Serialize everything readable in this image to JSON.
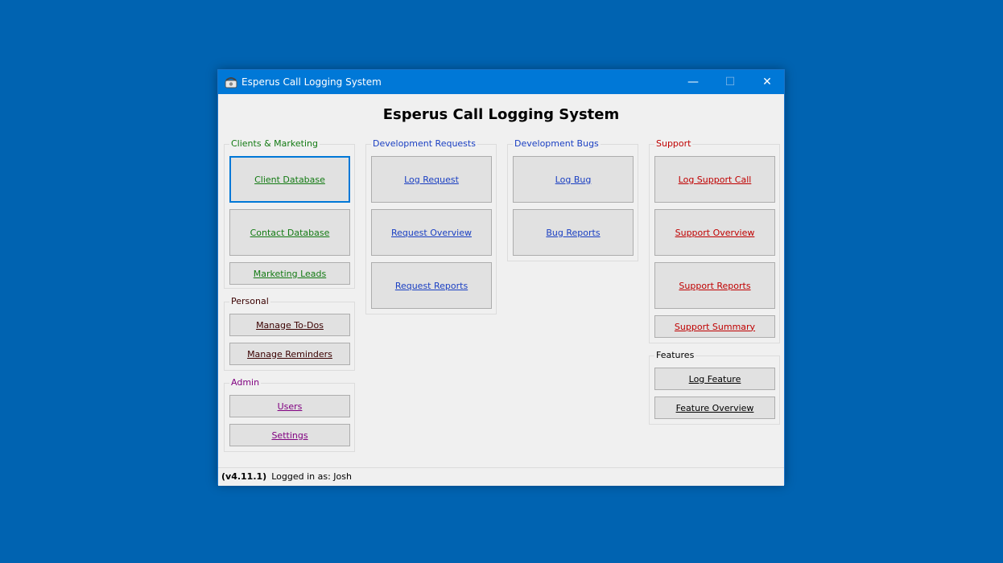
{
  "window": {
    "title": "Esperus Call Logging System",
    "minimize": "—",
    "maximize": "☐",
    "close": "✕"
  },
  "heading": "Esperus Call Logging System",
  "groups": {
    "clients": {
      "label": "Clients & Marketing",
      "buttons": [
        "Client Database",
        "Contact Database",
        "Marketing Leads"
      ]
    },
    "personal": {
      "label": "Personal",
      "buttons": [
        "Manage To-Dos",
        "Manage Reminders"
      ]
    },
    "admin": {
      "label": "Admin",
      "buttons": [
        "Users",
        "Settings"
      ]
    },
    "dev_requests": {
      "label": "Development Requests",
      "buttons": [
        "Log Request",
        "Request Overview",
        "Request Reports"
      ]
    },
    "dev_bugs": {
      "label": "Development Bugs",
      "buttons": [
        "Log Bug",
        "Bug Reports"
      ]
    },
    "support": {
      "label": "Support",
      "buttons": [
        "Log Support Call",
        "Support Overview",
        "Support Reports",
        "Support Summary"
      ]
    },
    "features": {
      "label": "Features",
      "buttons": [
        "Log Feature",
        "Feature Overview"
      ]
    }
  },
  "status": {
    "version": "(v4.11.1)",
    "logged_in": "Logged in as: Josh"
  },
  "colors": {
    "titlebar": "#0078d7",
    "desktop": "#0063b1",
    "clients": "#137a13",
    "development": "#1a3fc2",
    "support": "#c00000",
    "admin": "#800080"
  }
}
